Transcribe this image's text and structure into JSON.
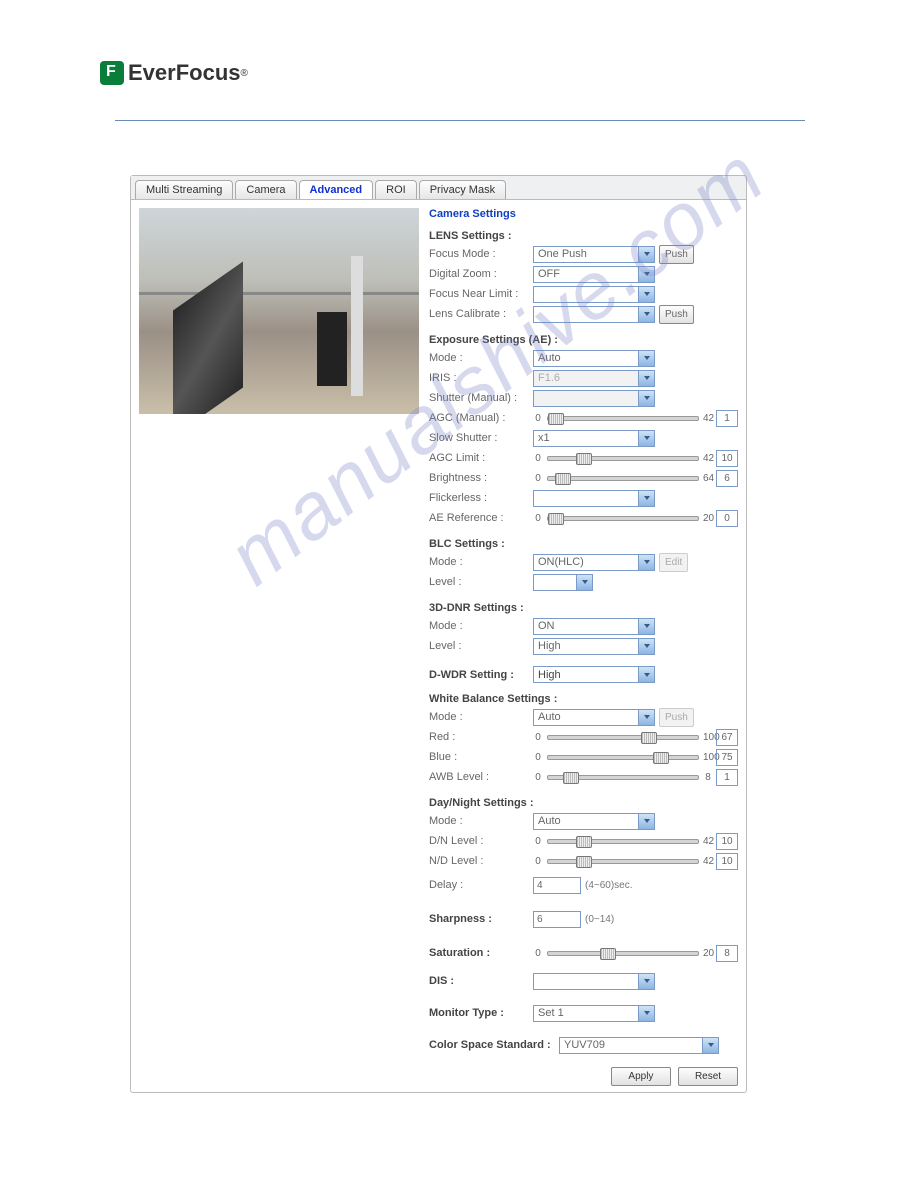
{
  "brand": {
    "name": "EverFocus",
    "tm": "®"
  },
  "tabs": [
    "Multi Streaming",
    "Camera",
    "Advanced",
    "ROI",
    "Privacy Mask"
  ],
  "watermark": "manualshive.com",
  "settings": {
    "title": "Camera Settings",
    "lens": {
      "heading": "LENS Settings :",
      "focus_mode": {
        "label": "Focus Mode :",
        "value": "One Push",
        "button": "Push"
      },
      "digital_zoom": {
        "label": "Digital Zoom :",
        "value": "OFF"
      },
      "focus_near_limit": {
        "label": "Focus Near Limit :"
      },
      "lens_calibrate": {
        "label": "Lens Calibrate :",
        "button": "Push"
      }
    },
    "ae": {
      "heading": "Exposure Settings (AE) :",
      "mode": {
        "label": "Mode :",
        "value": "Auto"
      },
      "iris": {
        "label": "IRIS :",
        "value": "F1.6"
      },
      "shutter": {
        "label": "Shutter (Manual) :"
      },
      "agc_manual": {
        "label": "AGC (Manual) :",
        "min": "0",
        "max": "42",
        "value": "1"
      },
      "slow_shutter": {
        "label": "Slow Shutter :",
        "value": "x1"
      },
      "agc_limit": {
        "label": "AGC Limit :",
        "min": "0",
        "max": "42",
        "value": "10"
      },
      "brightness": {
        "label": "Brightness :",
        "min": "0",
        "max": "64",
        "value": "6"
      },
      "flickerless": {
        "label": "Flickerless :"
      },
      "ae_reference": {
        "label": "AE Reference :",
        "min": "0",
        "max": "20",
        "value": "0"
      }
    },
    "blc": {
      "heading": "BLC Settings :",
      "mode": {
        "label": "Mode :",
        "value": "ON(HLC)",
        "button": "Edit"
      },
      "level": {
        "label": "Level :"
      }
    },
    "dnr": {
      "heading": "3D-DNR Settings :",
      "mode": {
        "label": "Mode :",
        "value": "ON"
      },
      "level": {
        "label": "Level :",
        "value": "High"
      }
    },
    "dwdr": {
      "label": "D-WDR Setting :",
      "value": "High"
    },
    "wb": {
      "heading": "White Balance Settings :",
      "mode": {
        "label": "Mode :",
        "value": "Auto",
        "button": "Push"
      },
      "red": {
        "label": "Red :",
        "min": "0",
        "max": "100",
        "value": "67"
      },
      "blue": {
        "label": "Blue :",
        "min": "0",
        "max": "100",
        "value": "75"
      },
      "awb": {
        "label": "AWB Level :",
        "min": "0",
        "max": "8",
        "value": "1"
      }
    },
    "dn": {
      "heading": "Day/Night Settings :",
      "mode": {
        "label": "Mode :",
        "value": "Auto"
      },
      "dn_level": {
        "label": "D/N Level :",
        "min": "0",
        "max": "42",
        "value": "10"
      },
      "nd_level": {
        "label": "N/D Level :",
        "min": "0",
        "max": "42",
        "value": "10"
      },
      "delay": {
        "label": "Delay :",
        "value": "4",
        "hint": "(4~60)sec."
      }
    },
    "sharpness": {
      "label": "Sharpness :",
      "value": "6",
      "hint": "(0~14)"
    },
    "saturation": {
      "label": "Saturation :",
      "min": "0",
      "max": "20",
      "value": "8"
    },
    "dis": {
      "label": "DIS :"
    },
    "monitor": {
      "label": "Monitor Type :",
      "value": "Set 1"
    },
    "color_space": {
      "label": "Color Space Standard :",
      "value": "YUV709"
    }
  },
  "footer": {
    "apply": "Apply",
    "reset": "Reset"
  }
}
